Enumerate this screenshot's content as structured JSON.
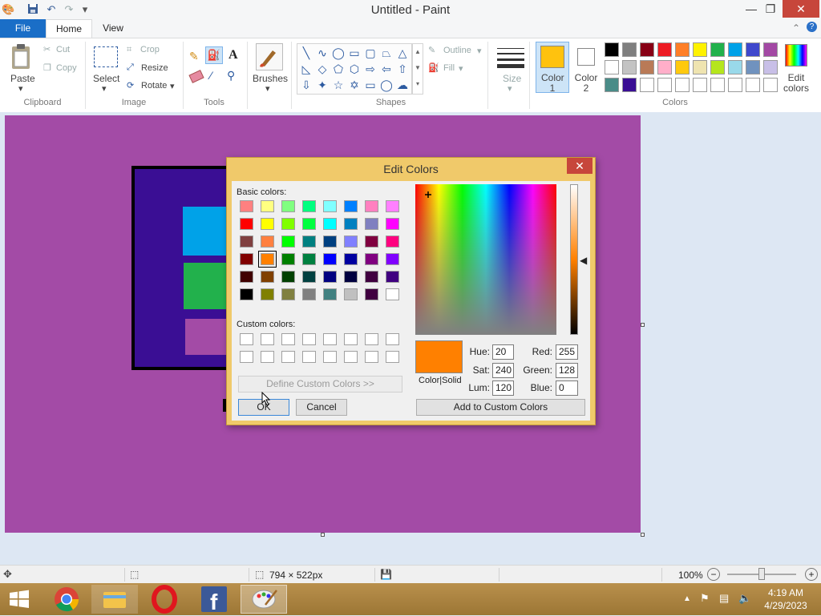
{
  "window": {
    "title": "Untitled - Paint",
    "controls": {
      "minimize": "—",
      "restore": "❐",
      "close": "✕"
    }
  },
  "tabs": {
    "file": "File",
    "home": "Home",
    "view": "View"
  },
  "ribbon": {
    "clipboard": {
      "label": "Clipboard",
      "paste": "Paste",
      "cut": "Cut",
      "copy": "Copy"
    },
    "image": {
      "label": "Image",
      "select": "Select",
      "crop": "Crop",
      "resize": "Resize",
      "rotate": "Rotate"
    },
    "tools": {
      "label": "Tools",
      "text_glyph": "A"
    },
    "brushes": {
      "label": "Brushes"
    },
    "shapes": {
      "label": "Shapes",
      "outline": "Outline",
      "fill": "Fill"
    },
    "size": {
      "label": "Size"
    },
    "colors": {
      "label": "Colors",
      "color1": "Color\n1",
      "color1_value": "#ffc20e",
      "color2": "Color\n2",
      "color2_value": "#ffffff",
      "edit": "Edit\ncolors",
      "palette_row1": [
        "#000000",
        "#7f7f7f",
        "#880015",
        "#ed1c24",
        "#ff7f27",
        "#fff200",
        "#22b14c",
        "#00a2e8",
        "#3f48cc",
        "#a349a4"
      ],
      "palette_row2": [
        "#ffffff",
        "#c3c3c3",
        "#b97a57",
        "#ffaec9",
        "#ffc90e",
        "#efe4b0",
        "#b5e61d",
        "#99d9ea",
        "#7092be",
        "#c8bfe7"
      ],
      "palette_row3": [
        "#4a8c88",
        "#3a0e94",
        "#ffffff",
        "#ffffff",
        "#ffffff",
        "#ffffff",
        "#ffffff",
        "#ffffff",
        "#ffffff",
        "#ffffff"
      ]
    }
  },
  "status": {
    "size": "794 × 522px",
    "zoom": "100%"
  },
  "taskbar": {
    "clock_time": "4:19 AM",
    "clock_date": "4/29/2023"
  },
  "dialog": {
    "title": "Edit Colors",
    "basic_colors_label": "Basic colors:",
    "custom_colors_label": "Custom colors:",
    "define_custom": "Define Custom Colors >>",
    "ok": "OK",
    "cancel": "Cancel",
    "add_custom": "Add to Custom Colors",
    "color_solid_label": "Color|Solid",
    "preview_color": "#ff8000",
    "selected_swatch_index": 25,
    "basic_colors": [
      "#ff8080",
      "#ffff80",
      "#80ff80",
      "#00ff80",
      "#80ffff",
      "#0080ff",
      "#ff80c0",
      "#ff80ff",
      "#ff0000",
      "#ffff00",
      "#80ff00",
      "#00ff40",
      "#00ffff",
      "#0080c0",
      "#8080c0",
      "#ff00ff",
      "#804040",
      "#ff8040",
      "#00ff00",
      "#008080",
      "#004080",
      "#8080ff",
      "#800040",
      "#ff0080",
      "#800000",
      "#ff8000",
      "#008000",
      "#008040",
      "#0000ff",
      "#0000a0",
      "#800080",
      "#8000ff",
      "#400000",
      "#804000",
      "#004000",
      "#004040",
      "#000080",
      "#000040",
      "#400040",
      "#400080",
      "#000000",
      "#808000",
      "#808040",
      "#808080",
      "#408080",
      "#c0c0c0",
      "#400040",
      "#ffffff"
    ],
    "fields": {
      "hue_label": "Hue:",
      "hue": "20",
      "sat_label": "Sat:",
      "sat": "240",
      "lum_label": "Lum:",
      "lum": "120",
      "red_label": "Red:",
      "red": "255",
      "green_label": "Green:",
      "green": "128",
      "blue_label": "Blue:",
      "blue": "0"
    }
  }
}
